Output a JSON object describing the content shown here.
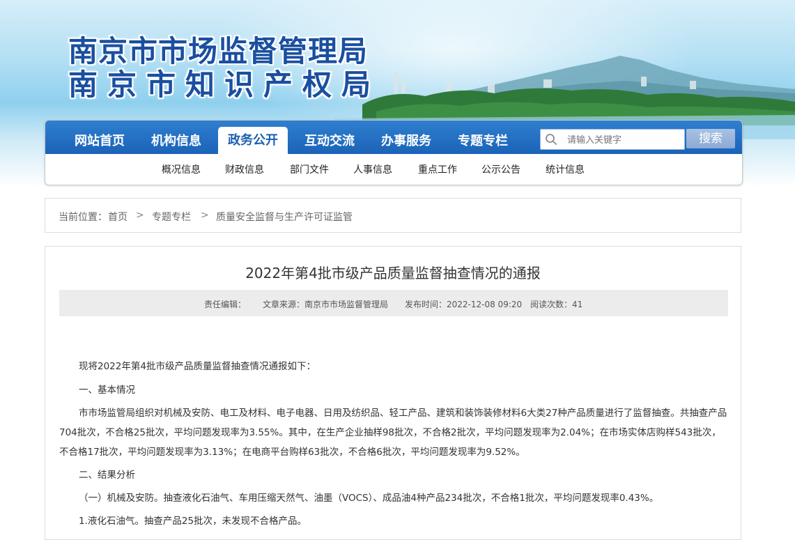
{
  "banner": {
    "title_line1": "南京市市场监督管理局",
    "title_line2": "南京市知识产权局"
  },
  "nav": {
    "items": [
      {
        "label": "网站首页",
        "active": false
      },
      {
        "label": "机构信息",
        "active": false
      },
      {
        "label": "政务公开",
        "active": true
      },
      {
        "label": "互动交流",
        "active": false
      },
      {
        "label": "办事服务",
        "active": false
      },
      {
        "label": "专题专栏",
        "active": false
      }
    ],
    "search_placeholder": "请输入关键字",
    "search_button": "搜索"
  },
  "subnav": {
    "items": [
      "概况信息",
      "财政信息",
      "部门文件",
      "人事信息",
      "重点工作",
      "公示公告",
      "统计信息"
    ]
  },
  "breadcrumb": {
    "prefix": "当前位置：",
    "items": [
      "首页",
      "专题专栏",
      "质量安全监督与生产许可证监管"
    ],
    "separator": ">"
  },
  "article": {
    "title": "2022年第4批市级产品质量监督抽查情况的通报",
    "meta": {
      "editor": "责任编辑：",
      "source": "文章来源：南京市市场监督管理局",
      "published": "发布时间：2022-12-08 09:20",
      "views": "阅读次数：41"
    },
    "paragraphs": [
      "现将2022年第4批市级产品质量监督抽查情况通报如下：",
      "一、基本情况",
      "市市场监管局组织对机械及安防、电工及材料、电子电器、日用及纺织品、轻工产品、建筑和装饰装修材料6大类27种产品质量进行了监督抽查。共抽查产品704批次，不合格25批次，平均问题发现率为3.55%。其中，在生产企业抽样98批次，不合格2批次，平均问题发现率为2.04%；在市场实体店购样543批次，不合格17批次，平均问题发现率为3.13%；在电商平台购样63批次，不合格6批次，平均问题发现率为9.52%。",
      "二、结果分析",
      "（一）机械及安防。抽查液化石油气、车用压缩天然气、油墨（VOCS）、成品油4种产品234批次，不合格1批次，平均问题发现率0.43%。",
      "1.液化石油气。抽查产品25批次，未发现不合格产品。"
    ]
  }
}
